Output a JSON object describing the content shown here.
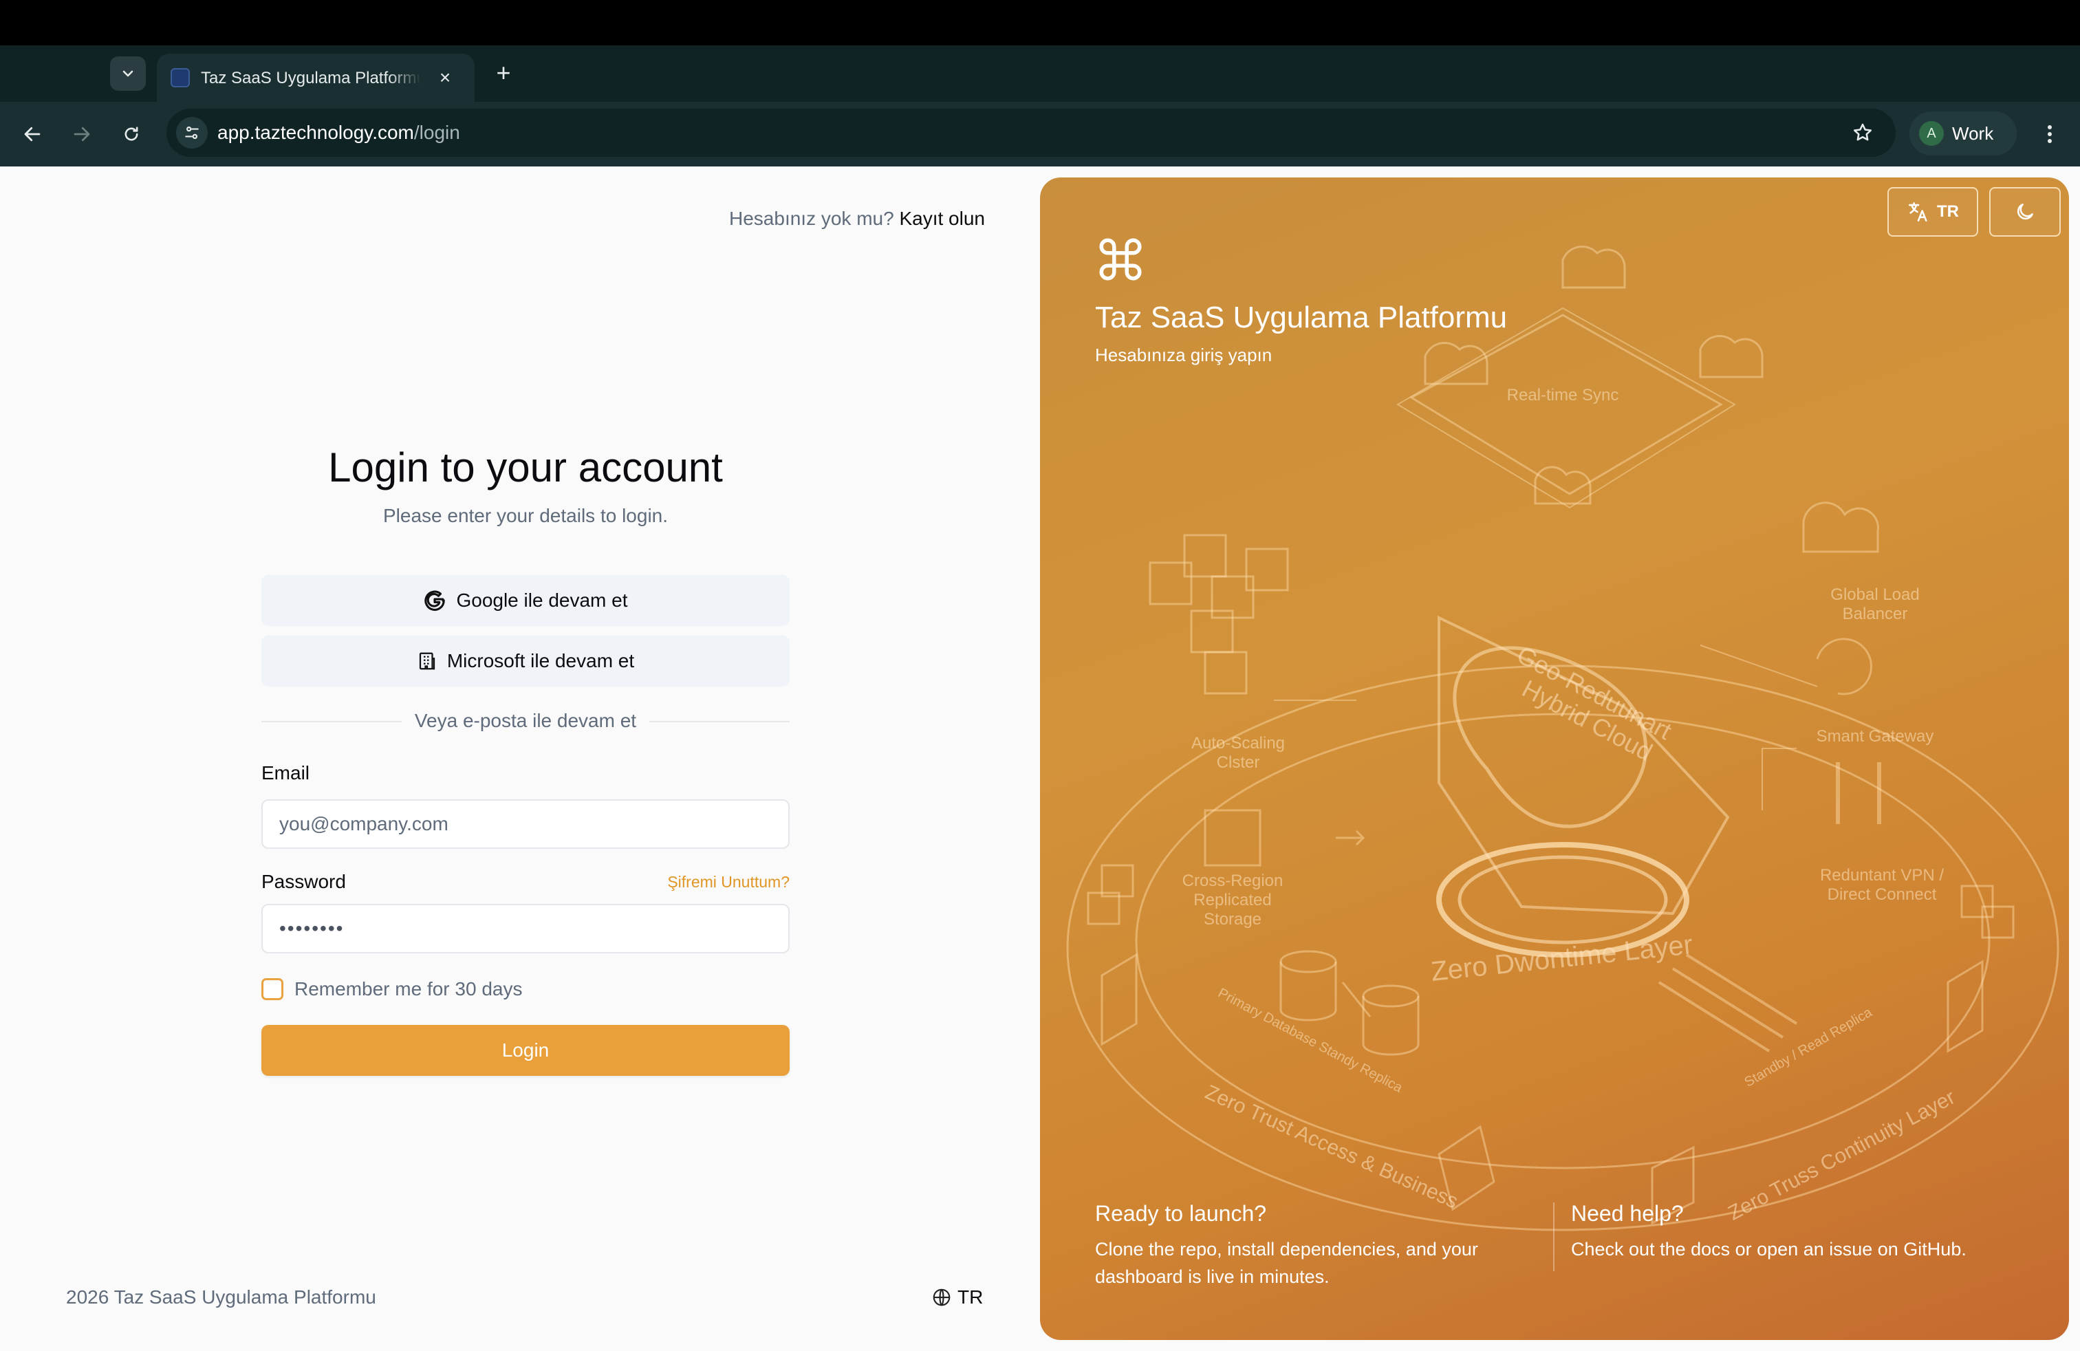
{
  "browser": {
    "tab_title": "Taz SaaS Uygulama Platformu",
    "url_host": "app.taztechnology.com",
    "url_path": "/login",
    "profile_initial": "A",
    "profile_label": "Work"
  },
  "auth_switch": {
    "question": "Hesabınız yok mu?",
    "link": "Kayıt olun"
  },
  "login": {
    "title": "Login to your account",
    "subtitle": "Please enter your details to login.",
    "google_button": "Google ile devam et",
    "microsoft_button": "Microsoft ile devam et",
    "divider": "Veya e-posta ile devam et",
    "email_label": "Email",
    "email_placeholder": "you@company.com",
    "password_label": "Password",
    "password_value": "••••••••",
    "forgot": "Şifremi Unuttum?",
    "remember": "Remember me for 30 days",
    "remember_checked": false,
    "submit": "Login"
  },
  "footer": {
    "copyright": "2026 Taz SaaS Uygulama Platformu",
    "language": "TR"
  },
  "hero": {
    "language_button": "TR",
    "theme_icon": "moon-icon",
    "logo_icon": "command-icon",
    "title": "Taz SaaS Uygulama Platformu",
    "subtitle": "Hesabınıza giriş yapın",
    "illustration": {
      "sync": "Real-time Sync",
      "load_balancer": [
        "Global Load",
        "Balancer"
      ],
      "gateway": "Smant Gateway",
      "autoscaling": [
        "Auto-Scaling",
        "Clster"
      ],
      "storage": [
        "Cross-Region",
        "Replicated",
        "Storage"
      ],
      "vpn": [
        "Reduntant VPN /",
        "Direct Connect"
      ],
      "cloud": [
        "Geo-Reduunart",
        "Hybrid Cloud"
      ],
      "zero_downtime": "Zero Dwontime Layer",
      "primary_db": "Primary Database  Standy Replica",
      "standby": "Standby / Read Replica",
      "zero_trust": "Zero Trust Access & Business",
      "continuity": "Zero Truss Continuity Layer"
    },
    "cards": [
      {
        "title": "Ready to launch?",
        "text": "Clone the repo, install dependencies, and your dashboard is live in minutes."
      },
      {
        "title": "Need help?",
        "text": "Check out the docs or open an issue on GitHub."
      }
    ]
  },
  "colors": {
    "accent": "#eaa03a",
    "link_accent": "#e09624",
    "hero_gradient_start": "#c98e3c",
    "hero_gradient_end": "#c46a30",
    "chrome_dark": "#0f2325"
  }
}
